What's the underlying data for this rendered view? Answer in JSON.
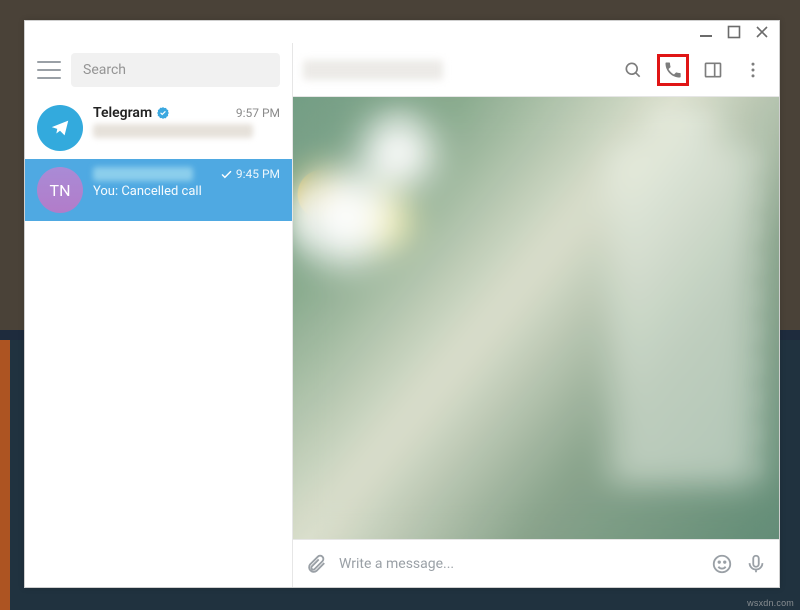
{
  "window_controls": {
    "min": "minimize-icon",
    "max": "maximize-icon",
    "close": "close-icon"
  },
  "sidebar": {
    "search_placeholder": "Search",
    "chats": [
      {
        "name": "Telegram",
        "verified": true,
        "time": "9:57 PM",
        "avatar": "telegram",
        "selected": false
      },
      {
        "initials": "TN",
        "time": "9:45 PM",
        "preview": "You: Cancelled call",
        "avatar": "tn",
        "selected": true,
        "delivered": true
      }
    ]
  },
  "header": {
    "icons": {
      "search": "search-icon",
      "call": "phone-icon",
      "panel": "sidebar-toggle-icon",
      "more": "more-icon"
    }
  },
  "composer": {
    "placeholder": "Write a message...",
    "icons": {
      "attach": "attach-icon",
      "emoji": "emoji-icon",
      "mic": "mic-icon"
    }
  },
  "watermark": "wsxdn.com",
  "colors": {
    "accent": "#4fa9e2",
    "highlight_box": "#e01515",
    "telegram_blue": "#33aadd"
  }
}
